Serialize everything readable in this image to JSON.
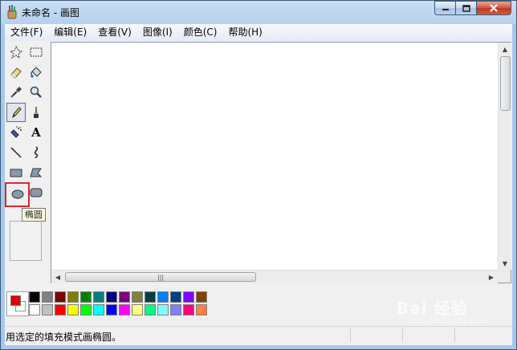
{
  "window": {
    "title": "未命名 - 画图",
    "controls": {
      "minimize": "minimize",
      "maximize": "maximize",
      "close": "close"
    }
  },
  "menu": [
    {
      "label": "文件(F)"
    },
    {
      "label": "编辑(E)"
    },
    {
      "label": "查看(V)"
    },
    {
      "label": "图像(I)"
    },
    {
      "label": "颜色(C)"
    },
    {
      "label": "帮助(H)"
    }
  ],
  "tools": [
    {
      "name": "free-form-select",
      "icon": "free-form-select-icon"
    },
    {
      "name": "rectangle-select",
      "icon": "rectangle-select-icon"
    },
    {
      "name": "eraser",
      "icon": "eraser-icon"
    },
    {
      "name": "fill-with-color",
      "icon": "paint-bucket-icon"
    },
    {
      "name": "pick-color",
      "icon": "eyedropper-icon"
    },
    {
      "name": "magnifier",
      "icon": "magnifier-icon"
    },
    {
      "name": "pencil",
      "icon": "pencil-icon",
      "pressed": true
    },
    {
      "name": "brush",
      "icon": "brush-icon"
    },
    {
      "name": "airbrush",
      "icon": "airbrush-icon"
    },
    {
      "name": "text",
      "icon": "text-icon",
      "glyph": "A"
    },
    {
      "name": "line",
      "icon": "line-icon"
    },
    {
      "name": "curve",
      "icon": "curve-icon"
    },
    {
      "name": "rectangle",
      "icon": "rectangle-icon"
    },
    {
      "name": "polygon",
      "icon": "polygon-icon"
    },
    {
      "name": "ellipse",
      "icon": "ellipse-icon",
      "highlighted": true
    },
    {
      "name": "rounded-rectangle",
      "icon": "rounded-rectangle-icon"
    }
  ],
  "tooltip": {
    "text": "椭圆"
  },
  "colors": {
    "foreground": "#e00000",
    "background": "#ffffff",
    "palette_top": [
      "#000000",
      "#808080",
      "#800000",
      "#808000",
      "#008000",
      "#008080",
      "#000080",
      "#800080",
      "#808040",
      "#004040",
      "#0080ff",
      "#004080",
      "#8000ff",
      "#804000"
    ],
    "palette_bottom": [
      "#ffffff",
      "#c0c0c0",
      "#ff0000",
      "#ffff00",
      "#00ff00",
      "#00ffff",
      "#0000ff",
      "#ff00ff",
      "#ffff80",
      "#00ff80",
      "#80ffff",
      "#8080ff",
      "#ff0080",
      "#ff8040"
    ]
  },
  "status": {
    "text": "用选定的填充模式画椭圆。"
  },
  "watermark": {
    "text": "Bai 经验",
    "sub": "jingyan.baidu.com"
  }
}
